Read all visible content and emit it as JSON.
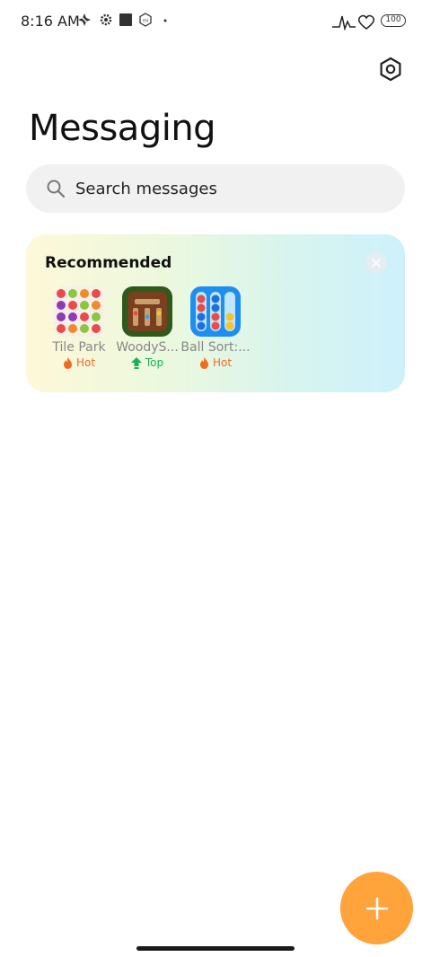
{
  "status_bar": {
    "time": "8:16 AM",
    "battery": "100",
    "left_icons": [
      "fan-icon",
      "settings-gear-icon",
      "square-icon",
      "mi-icon",
      "dot-icon"
    ],
    "right_icons": [
      "heartbeat-signal-icon",
      "heart-icon",
      "battery-icon"
    ]
  },
  "header": {
    "title": "Messaging",
    "settings_icon": "settings-icon"
  },
  "search": {
    "placeholder": "Search messages"
  },
  "recommended": {
    "title": "Recommended",
    "apps": [
      {
        "name": "Tile Park",
        "badge": "Hot",
        "badge_type": "hot"
      },
      {
        "name": "WoodyS...",
        "badge": "Top",
        "badge_type": "top"
      },
      {
        "name": "Ball Sort:...",
        "badge": "Hot",
        "badge_type": "hot"
      }
    ]
  },
  "colors": {
    "fab": "#ffa33a",
    "hot": "#f26b1d",
    "top": "#19b05a"
  }
}
